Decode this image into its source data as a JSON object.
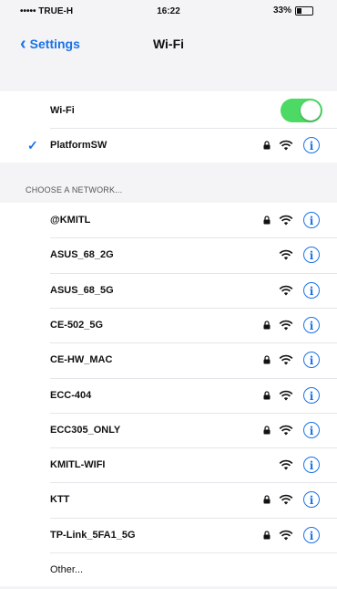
{
  "status_bar": {
    "carrier": "••••• TRUE-H",
    "time": "16:22",
    "battery": "33%",
    "battery_fill": 0.33
  },
  "nav": {
    "back_label": "Settings",
    "title": "Wi-Fi"
  },
  "wifi_toggle": {
    "label": "Wi-Fi",
    "on": true,
    "color": "#4cd964"
  },
  "connected": {
    "name": "PlatformSW",
    "secured": true
  },
  "section_header": "CHOOSE A NETWORK...",
  "networks": [
    {
      "name": "@KMITL",
      "secured": true
    },
    {
      "name": "ASUS_68_2G",
      "secured": false
    },
    {
      "name": "ASUS_68_5G",
      "secured": false
    },
    {
      "name": "CE-502_5G",
      "secured": true
    },
    {
      "name": "CE-HW_MAC",
      "secured": true
    },
    {
      "name": "ECC-404",
      "secured": true
    },
    {
      "name": "ECC305_ONLY",
      "secured": true
    },
    {
      "name": "KMITL-WIFI",
      "secured": false
    },
    {
      "name": "KTT",
      "secured": true
    },
    {
      "name": "TP-Link_5FA1_5G",
      "secured": true
    }
  ],
  "other_label": "Other...",
  "colors": {
    "accent": "#1a73e8",
    "toggle_on": "#4cd964"
  },
  "icons": [
    "chevron-left-icon",
    "checkmark-icon",
    "lock-icon",
    "wifi-icon",
    "info-icon",
    "battery-icon",
    "wifi-status-icon"
  ]
}
